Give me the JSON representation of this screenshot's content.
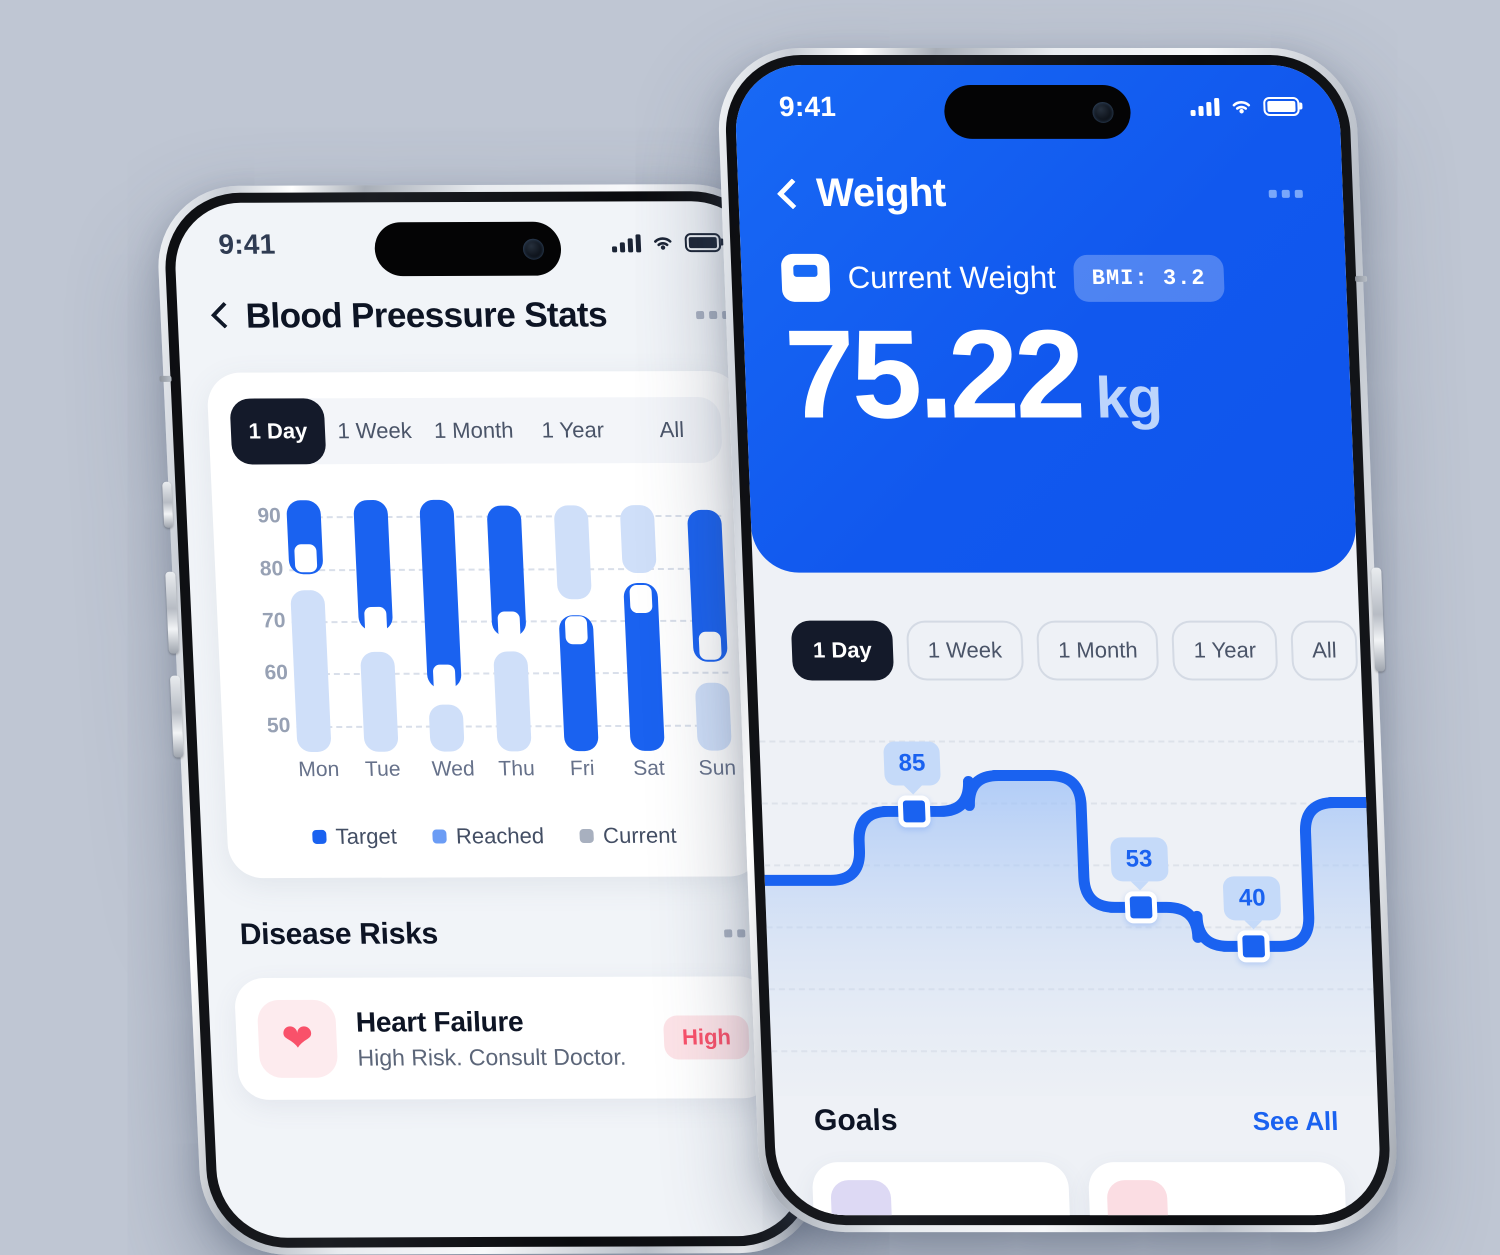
{
  "background_color": "#bfc6d3",
  "colors": {
    "brand_blue": "#1a62f0",
    "target": "#1a62f0",
    "reached": "#6b9cf5",
    "current": "#a8b0bf",
    "light_bar": "#cfdff9",
    "dark_pill": "#141a2a",
    "risk_red": "#f9516a"
  },
  "left_phone": {
    "status_bar": {
      "time": "9:41",
      "signal_icon": "cellular-signal-icon",
      "wifi_icon": "wifi-icon",
      "battery_icon": "battery-icon"
    },
    "nav": {
      "back_icon": "chevron-left-icon",
      "title": "Blood Preessure Stats",
      "more_icon": "more-horizontal-icon"
    },
    "range_tabs": [
      {
        "label": "1 Day",
        "active": true
      },
      {
        "label": "1 Week",
        "active": false
      },
      {
        "label": "1 Month",
        "active": false
      },
      {
        "label": "1 Year",
        "active": false
      },
      {
        "label": "All",
        "active": false
      }
    ],
    "legend": [
      {
        "label": "Target",
        "color": "#1a62f0"
      },
      {
        "label": "Reached",
        "color": "#6b9cf5"
      },
      {
        "label": "Current",
        "color": "#a8b0bf"
      }
    ],
    "disease_risks": {
      "section_title": "Disease Risks",
      "more_icon": "more-horizontal-icon",
      "items": [
        {
          "icon": "heart-icon",
          "name": "Heart Failure",
          "description": "High Risk. Consult Doctor.",
          "badge": "High"
        }
      ]
    }
  },
  "right_phone": {
    "status_bar": {
      "time": "9:41",
      "signal_icon": "cellular-signal-icon",
      "wifi_icon": "wifi-icon",
      "battery_icon": "battery-icon"
    },
    "nav": {
      "back_icon": "chevron-left-icon",
      "title": "Weight",
      "more_icon": "more-horizontal-icon"
    },
    "hero": {
      "scale_icon": "scale-icon",
      "label": "Current Weight",
      "bmi_badge": "BMI: 3.2",
      "value": "75.22",
      "unit": "kg"
    },
    "range_tabs": [
      {
        "label": "1 Day",
        "active": true
      },
      {
        "label": "1 Week",
        "active": false
      },
      {
        "label": "1 Month",
        "active": false
      },
      {
        "label": "1 Year",
        "active": false
      },
      {
        "label": "All",
        "active": false
      }
    ],
    "goals": {
      "title": "Goals",
      "see_all": "See All"
    }
  },
  "chart_data": [
    {
      "type": "bar",
      "title": "Blood Preessure Stats",
      "subtype": "floating-range-bars",
      "xlabel": "",
      "ylabel": "",
      "ylim": [
        45,
        95
      ],
      "grid": true,
      "yticks": [
        90,
        80,
        70,
        60,
        50
      ],
      "categories": [
        "Mon",
        "Tue",
        "Wed",
        "Thu",
        "Fri",
        "Sat",
        "Sun"
      ],
      "legend": [
        "Target",
        "Reached",
        "Current"
      ],
      "legend_position": "bottom-center",
      "series": [
        {
          "name": "Target",
          "color": "#1a62f0",
          "ranges": [
            [
              79,
              93
            ],
            [
              68,
              93
            ],
            [
              57,
              93
            ],
            [
              67,
              92
            ],
            [
              45,
              71
            ],
            [
              45,
              77
            ],
            [
              62,
              91
            ]
          ]
        },
        {
          "name": "Reached",
          "color": "#cfdff9",
          "ranges": [
            [
              45,
              76
            ],
            [
              45,
              64
            ],
            [
              45,
              54
            ],
            [
              45,
              64
            ],
            [
              74,
              92
            ],
            [
              79,
              92
            ],
            [
              45,
              58
            ]
          ]
        },
        {
          "name": "Current",
          "color": "#ffffff",
          "values": [
            82,
            70,
            59,
            69,
            68,
            74,
            65
          ]
        }
      ]
    },
    {
      "type": "line",
      "subtype": "stepped-area",
      "title": "Weight",
      "xlabel": "",
      "ylabel": "",
      "grid": true,
      "ylim": [
        0,
        100
      ],
      "labels_shown": [
        "85",
        "53",
        "40"
      ],
      "x": [
        0,
        1,
        2,
        3,
        4,
        5
      ],
      "values": [
        62,
        85,
        97,
        53,
        40,
        88
      ],
      "line_color": "#1a62f0",
      "fill": "gradient-blue-fade",
      "marker_shape": "rounded-square"
    }
  ]
}
